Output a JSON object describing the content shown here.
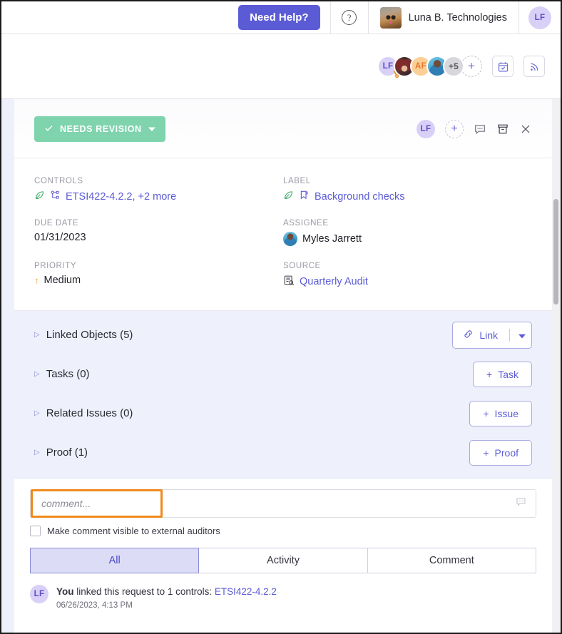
{
  "header": {
    "need_help_label": "Need Help?",
    "help_icon": "question-circle-icon",
    "org_name": "Luna B. Technologies",
    "user_initials": "LF"
  },
  "toolbar": {
    "avatars": [
      {
        "initials": "LF",
        "type": "initials",
        "badge": "key"
      },
      {
        "initials": "",
        "type": "photo"
      },
      {
        "initials": "AF",
        "type": "initials"
      },
      {
        "initials": "",
        "type": "photo"
      },
      {
        "initials": "+5",
        "type": "count"
      }
    ],
    "add_label": "+",
    "calendar_icon": "calendar-check-icon",
    "feed_icon": "rss-feed-icon"
  },
  "status": {
    "badge_label": "NEEDS REVISION",
    "badge_color": "#7fd3ad",
    "check_icon": "check-icon",
    "chevron_icon": "chevron-down-icon",
    "avatar_initials": "LF",
    "add_label": "+",
    "comment_icon": "comment-icon",
    "archive_icon": "archive-icon",
    "close_icon": "close-icon"
  },
  "meta": {
    "controls": {
      "label": "CONTROLS",
      "value": "ETSI422-4.2.2, +2 more",
      "leaf_icon": "leaf-icon",
      "node_icon": "sitemap-icon"
    },
    "label_field": {
      "label": "LABEL",
      "value": "Background checks",
      "leaf_icon": "leaf-icon",
      "tag_icon": "bookmark-tag-icon"
    },
    "due_date": {
      "label": "DUE DATE",
      "value": "01/31/2023"
    },
    "assignee": {
      "label": "ASSIGNEE",
      "value": "Myles Jarrett",
      "avatar_icon": "user-avatar"
    },
    "priority": {
      "label": "PRIORITY",
      "value": "Medium",
      "arrow_icon": "arrow-up-icon",
      "arrow_color": "#f3a23c"
    },
    "source": {
      "label": "SOURCE",
      "value": "Quarterly Audit",
      "doc_icon": "document-search-icon"
    }
  },
  "sections": [
    {
      "title": "Linked Objects (5)",
      "button_label": "Link",
      "button_icon": "chain-link-icon",
      "has_dropdown": true,
      "dropdown_icon": "chevron-down-icon"
    },
    {
      "title": "Tasks (0)",
      "button_label": "Task",
      "button_icon": "plus-icon",
      "has_dropdown": false
    },
    {
      "title": "Related Issues (0)",
      "button_label": "Issue",
      "button_icon": "plus-icon",
      "has_dropdown": false
    },
    {
      "title": "Proof (1)",
      "button_label": "Proof",
      "button_icon": "plus-icon",
      "has_dropdown": false
    }
  ],
  "comment": {
    "placeholder": "comment...",
    "value": "",
    "icon": "comment-icon",
    "checkbox_label": "Make comment visible to external auditors",
    "checkbox_checked": false,
    "highlight_color": "#f08a1d"
  },
  "tabs": [
    {
      "label": "All",
      "active": true
    },
    {
      "label": "Activity",
      "active": false
    },
    {
      "label": "Comment",
      "active": false
    }
  ],
  "activity": [
    {
      "avatar_initials": "LF",
      "actor": "You",
      "text": " linked this request to 1 controls: ",
      "link": "ETSI422-4.2.2",
      "timestamp": "06/26/2023, 4:13 PM"
    }
  ]
}
